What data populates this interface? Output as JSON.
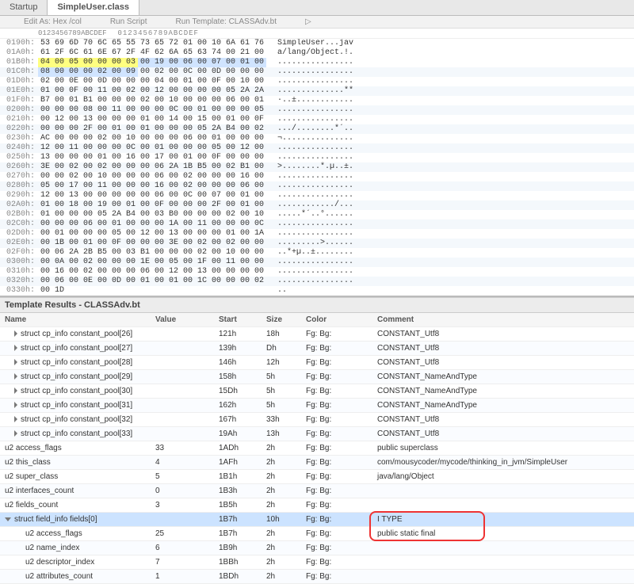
{
  "tabs": [
    "Startup",
    "SimpleUser.class"
  ],
  "active_tab": 1,
  "toolbar": {
    "edit_as": "Edit As: Hex /col",
    "run_script": "Run Script",
    "run_template": "Run Template: CLASSAdv.bt"
  },
  "hex_header_hex": [
    "0",
    "1",
    "2",
    "3",
    "4",
    "5",
    "6",
    "7",
    "8",
    "9",
    "A",
    "B",
    "C",
    "D",
    "E",
    "F"
  ],
  "hex_header_ascii": "0123456789ABCDEF",
  "rows": [
    {
      "addr": "0190h:",
      "bytes": [
        "53",
        "69",
        "6D",
        "70",
        "6C",
        "65",
        "55",
        "73",
        "65",
        "72",
        "01",
        "00",
        "10",
        "6A",
        "61",
        "76"
      ],
      "ascii": "SimpleUser...jav",
      "hlbytes": [],
      "band": 0
    },
    {
      "addr": "01A0h:",
      "bytes": [
        "61",
        "2F",
        "6C",
        "61",
        "6E",
        "67",
        "2F",
        "4F",
        "62",
        "6A",
        "65",
        "63",
        "74",
        "00",
        "21",
        "00"
      ],
      "ascii": "a/lang/Object.!.",
      "hlbytes": [],
      "band": 0
    },
    {
      "addr": "01B0h:",
      "bytes": [
        "04",
        "00",
        "05",
        "00",
        "00",
        "00",
        "03",
        "00",
        "19",
        "00",
        "06",
        "00",
        "07",
        "00",
        "01",
        "00"
      ],
      "ascii": "................",
      "hlbytes": [
        0,
        1,
        2,
        3,
        4,
        5,
        6
      ],
      "hl2": [
        7,
        8,
        9,
        10,
        11,
        12,
        13,
        14,
        15
      ],
      "band": 0
    },
    {
      "addr": "01C0h:",
      "bytes": [
        "08",
        "00",
        "00",
        "00",
        "02",
        "00",
        "09",
        "00",
        "02",
        "00",
        "0C",
        "00",
        "0D",
        "00",
        "00",
        "00"
      ],
      "ascii": "................",
      "hlbytes": [],
      "hl2": [
        0,
        1,
        2,
        3,
        4,
        5,
        6
      ],
      "band": 1
    },
    {
      "addr": "01D0h:",
      "bytes": [
        "02",
        "00",
        "0E",
        "00",
        "0D",
        "00",
        "00",
        "00",
        "04",
        "00",
        "01",
        "00",
        "0F",
        "00",
        "10",
        "00"
      ],
      "ascii": "................",
      "hlbytes": [],
      "band": 0
    },
    {
      "addr": "01E0h:",
      "bytes": [
        "01",
        "00",
        "0F",
        "00",
        "11",
        "00",
        "02",
        "00",
        "12",
        "00",
        "00",
        "00",
        "00",
        "05",
        "2A",
        "2A"
      ],
      "ascii": "..............**",
      "hlbytes": [],
      "band": 1
    },
    {
      "addr": "01F0h:",
      "bytes": [
        "B7",
        "00",
        "01",
        "B1",
        "00",
        "00",
        "00",
        "02",
        "00",
        "10",
        "00",
        "00",
        "00",
        "06",
        "00",
        "01"
      ],
      "ascii": "·..±............",
      "hlbytes": [],
      "band": 0
    },
    {
      "addr": "0200h:",
      "bytes": [
        "00",
        "00",
        "00",
        "08",
        "00",
        "11",
        "00",
        "00",
        "00",
        "0C",
        "00",
        "01",
        "00",
        "00",
        "00",
        "05"
      ],
      "ascii": "................",
      "hlbytes": [],
      "band": 1
    },
    {
      "addr": "0210h:",
      "bytes": [
        "00",
        "12",
        "00",
        "13",
        "00",
        "00",
        "00",
        "01",
        "00",
        "14",
        "00",
        "15",
        "00",
        "01",
        "00",
        "0F"
      ],
      "ascii": "................",
      "hlbytes": [],
      "band": 0
    },
    {
      "addr": "0220h:",
      "bytes": [
        "00",
        "00",
        "00",
        "2F",
        "00",
        "01",
        "00",
        "01",
        "00",
        "00",
        "00",
        "05",
        "2A",
        "B4",
        "00",
        "02"
      ],
      "ascii": ".../........*´..",
      "hlbytes": [],
      "band": 1
    },
    {
      "addr": "0230h:",
      "bytes": [
        "AC",
        "00",
        "00",
        "00",
        "02",
        "00",
        "10",
        "00",
        "00",
        "00",
        "06",
        "00",
        "01",
        "00",
        "00",
        "00"
      ],
      "ascii": "¬...............",
      "hlbytes": [],
      "band": 0
    },
    {
      "addr": "0240h:",
      "bytes": [
        "12",
        "00",
        "11",
        "00",
        "00",
        "00",
        "0C",
        "00",
        "01",
        "00",
        "00",
        "00",
        "05",
        "00",
        "12",
        "00"
      ],
      "ascii": "................",
      "hlbytes": [],
      "band": 1
    },
    {
      "addr": "0250h:",
      "bytes": [
        "13",
        "00",
        "00",
        "00",
        "01",
        "00",
        "16",
        "00",
        "17",
        "00",
        "01",
        "00",
        "0F",
        "00",
        "00",
        "00"
      ],
      "ascii": "................",
      "hlbytes": [],
      "band": 0
    },
    {
      "addr": "0260h:",
      "bytes": [
        "3E",
        "00",
        "02",
        "00",
        "02",
        "00",
        "00",
        "00",
        "06",
        "2A",
        "1B",
        "B5",
        "00",
        "02",
        "B1",
        "00"
      ],
      "ascii": ">........*.µ..±.",
      "hlbytes": [],
      "band": 1
    },
    {
      "addr": "0270h:",
      "bytes": [
        "00",
        "00",
        "02",
        "00",
        "10",
        "00",
        "00",
        "00",
        "06",
        "00",
        "02",
        "00",
        "00",
        "00",
        "16",
        "00"
      ],
      "ascii": "................",
      "hlbytes": [],
      "band": 0
    },
    {
      "addr": "0280h:",
      "bytes": [
        "05",
        "00",
        "17",
        "00",
        "11",
        "00",
        "00",
        "00",
        "16",
        "00",
        "02",
        "00",
        "00",
        "00",
        "06",
        "00"
      ],
      "ascii": "................",
      "hlbytes": [],
      "band": 1
    },
    {
      "addr": "0290h:",
      "bytes": [
        "12",
        "00",
        "13",
        "00",
        "00",
        "00",
        "00",
        "00",
        "06",
        "00",
        "0C",
        "00",
        "07",
        "00",
        "01",
        "00"
      ],
      "ascii": "................",
      "hlbytes": [],
      "band": 0
    },
    {
      "addr": "02A0h:",
      "bytes": [
        "01",
        "00",
        "18",
        "00",
        "19",
        "00",
        "01",
        "00",
        "0F",
        "00",
        "00",
        "00",
        "2F",
        "00",
        "01",
        "00"
      ],
      "ascii": "............/...",
      "hlbytes": [],
      "band": 1
    },
    {
      "addr": "02B0h:",
      "bytes": [
        "01",
        "00",
        "00",
        "00",
        "05",
        "2A",
        "B4",
        "00",
        "03",
        "B0",
        "00",
        "00",
        "00",
        "02",
        "00",
        "10"
      ],
      "ascii": ".....*´..°......",
      "hlbytes": [],
      "band": 0
    },
    {
      "addr": "02C0h:",
      "bytes": [
        "00",
        "00",
        "00",
        "06",
        "00",
        "01",
        "00",
        "00",
        "00",
        "1A",
        "00",
        "11",
        "00",
        "00",
        "00",
        "0C"
      ],
      "ascii": "................",
      "hlbytes": [],
      "band": 1
    },
    {
      "addr": "02D0h:",
      "bytes": [
        "00",
        "01",
        "00",
        "00",
        "00",
        "05",
        "00",
        "12",
        "00",
        "13",
        "00",
        "00",
        "00",
        "01",
        "00",
        "1A"
      ],
      "ascii": "................",
      "hlbytes": [],
      "band": 0
    },
    {
      "addr": "02E0h:",
      "bytes": [
        "00",
        "1B",
        "00",
        "01",
        "00",
        "0F",
        "00",
        "00",
        "00",
        "3E",
        "00",
        "02",
        "00",
        "02",
        "00",
        "00"
      ],
      "ascii": ".........>......",
      "hlbytes": [],
      "band": 1
    },
    {
      "addr": "02F0h:",
      "bytes": [
        "00",
        "06",
        "2A",
        "2B",
        "B5",
        "00",
        "03",
        "B1",
        "00",
        "00",
        "00",
        "02",
        "00",
        "10",
        "00",
        "00"
      ],
      "ascii": "..*+µ..±........",
      "hlbytes": [],
      "band": 0
    },
    {
      "addr": "0300h:",
      "bytes": [
        "00",
        "0A",
        "00",
        "02",
        "00",
        "00",
        "00",
        "1E",
        "00",
        "05",
        "00",
        "1F",
        "00",
        "11",
        "00",
        "00"
      ],
      "ascii": "................",
      "hlbytes": [],
      "band": 1
    },
    {
      "addr": "0310h:",
      "bytes": [
        "00",
        "16",
        "00",
        "02",
        "00",
        "00",
        "00",
        "06",
        "00",
        "12",
        "00",
        "13",
        "00",
        "00",
        "00",
        "00"
      ],
      "ascii": "................",
      "hlbytes": [],
      "band": 0
    },
    {
      "addr": "0320h:",
      "bytes": [
        "00",
        "06",
        "00",
        "0E",
        "00",
        "0D",
        "00",
        "01",
        "00",
        "01",
        "00",
        "1C",
        "00",
        "00",
        "00",
        "02"
      ],
      "ascii": "................",
      "hlbytes": [],
      "band": 1
    },
    {
      "addr": "0330h:",
      "bytes": [
        "00",
        "1D",
        "",
        "",
        "",
        "",
        "",
        "",
        "",
        "",
        "",
        "",
        "",
        "",
        "",
        ""
      ],
      "ascii": "..",
      "hlbytes": [],
      "band": 0
    }
  ],
  "results": {
    "title": "Template Results - CLASSAdv.bt",
    "cols": [
      "Name",
      "Value",
      "Start",
      "Size",
      "Color",
      "Comment"
    ],
    "rows": [
      {
        "n": "struct cp_info constant_pool[26]",
        "v": "",
        "s": "121h",
        "z": "18h",
        "c": "Fg:    Bg:",
        "m": "CONSTANT_Utf8",
        "ind": 1,
        "tri": "right"
      },
      {
        "n": "struct cp_info constant_pool[27]",
        "v": "",
        "s": "139h",
        "z": "Dh",
        "c": "Fg:    Bg:",
        "m": "CONSTANT_Utf8",
        "ind": 1,
        "tri": "right"
      },
      {
        "n": "struct cp_info constant_pool[28]",
        "v": "",
        "s": "146h",
        "z": "12h",
        "c": "Fg:    Bg:",
        "m": "CONSTANT_Utf8",
        "ind": 1,
        "tri": "right"
      },
      {
        "n": "struct cp_info constant_pool[29]",
        "v": "",
        "s": "158h",
        "z": "5h",
        "c": "Fg:    Bg:",
        "m": "CONSTANT_NameAndType",
        "ind": 1,
        "tri": "right"
      },
      {
        "n": "struct cp_info constant_pool[30]",
        "v": "",
        "s": "15Dh",
        "z": "5h",
        "c": "Fg:    Bg:",
        "m": "CONSTANT_NameAndType",
        "ind": 1,
        "tri": "right"
      },
      {
        "n": "struct cp_info constant_pool[31]",
        "v": "",
        "s": "162h",
        "z": "5h",
        "c": "Fg:    Bg:",
        "m": "CONSTANT_NameAndType",
        "ind": 1,
        "tri": "right"
      },
      {
        "n": "struct cp_info constant_pool[32]",
        "v": "",
        "s": "167h",
        "z": "33h",
        "c": "Fg:    Bg:",
        "m": "CONSTANT_Utf8",
        "ind": 1,
        "tri": "right"
      },
      {
        "n": "struct cp_info constant_pool[33]",
        "v": "",
        "s": "19Ah",
        "z": "13h",
        "c": "Fg:    Bg:",
        "m": "CONSTANT_Utf8",
        "ind": 1,
        "tri": "right"
      },
      {
        "n": "u2 access_flags",
        "v": "33",
        "s": "1ADh",
        "z": "2h",
        "c": "Fg:    Bg:",
        "m": "public superclass",
        "ind": 0
      },
      {
        "n": "u2 this_class",
        "v": "4",
        "s": "1AFh",
        "z": "2h",
        "c": "Fg:    Bg:",
        "m": "com/mousycoder/mycode/thinking_in_jvm/SimpleUser",
        "ind": 0
      },
      {
        "n": "u2 super_class",
        "v": "5",
        "s": "1B1h",
        "z": "2h",
        "c": "Fg:    Bg:",
        "m": "java/lang/Object",
        "ind": 0
      },
      {
        "n": "u2 interfaces_count",
        "v": "0",
        "s": "1B3h",
        "z": "2h",
        "c": "Fg:    Bg:",
        "m": "",
        "ind": 0
      },
      {
        "n": "u2 fields_count",
        "v": "3",
        "s": "1B5h",
        "z": "2h",
        "c": "Fg:    Bg:",
        "m": "",
        "ind": 0
      },
      {
        "n": "struct field_info fields[0]",
        "v": "",
        "s": "1B7h",
        "z": "10h",
        "c": "Fg:    Bg:",
        "m": "I TYPE",
        "ind": 0,
        "tri": "down",
        "sel": true,
        "box": true
      },
      {
        "n": "u2 access_flags",
        "v": "25",
        "s": "1B7h",
        "z": "2h",
        "c": "Fg:    Bg:",
        "m": "public static final",
        "ind": 2,
        "box": true
      },
      {
        "n": "u2 name_index",
        "v": "6",
        "s": "1B9h",
        "z": "2h",
        "c": "Fg:    Bg:",
        "m": "",
        "ind": 2
      },
      {
        "n": "u2 descriptor_index",
        "v": "7",
        "s": "1BBh",
        "z": "2h",
        "c": "Fg:    Bg:",
        "m": "",
        "ind": 2
      },
      {
        "n": "u2 attributes_count",
        "v": "1",
        "s": "1BDh",
        "z": "2h",
        "c": "Fg:    Bg:",
        "m": "",
        "ind": 2
      }
    ]
  }
}
